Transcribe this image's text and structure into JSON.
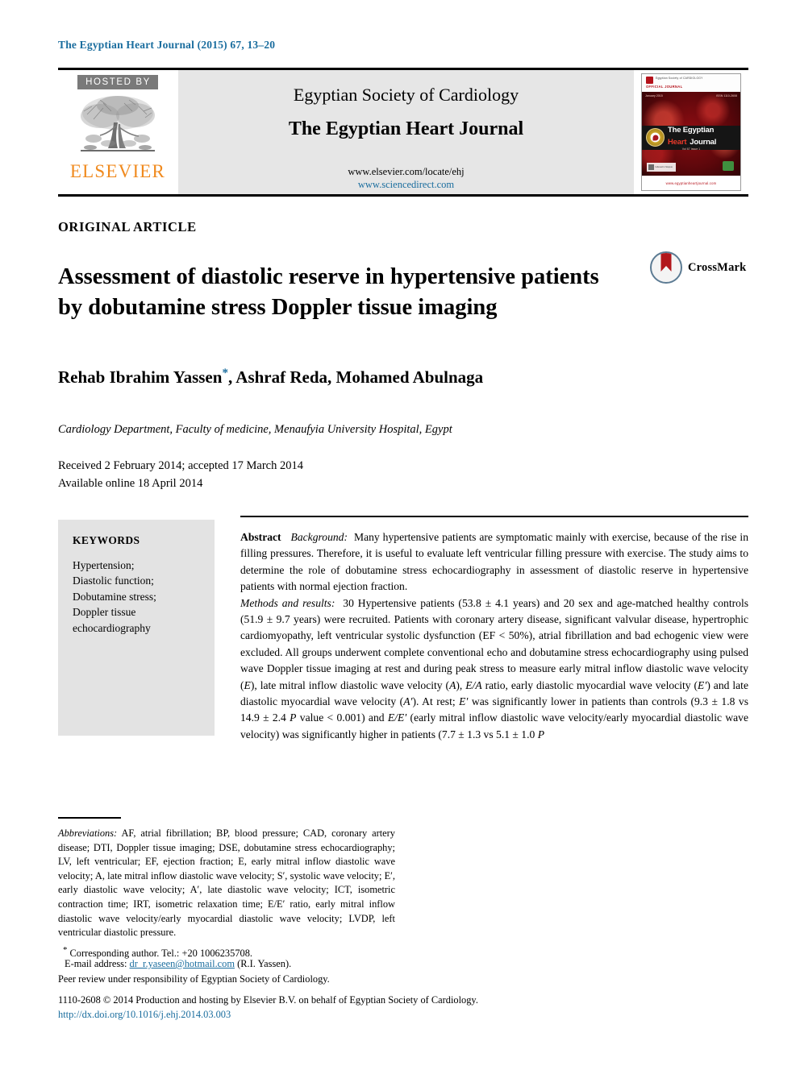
{
  "journal_ref": "The Egyptian Heart Journal (2015) 67, 13–20",
  "masthead": {
    "hosted_by": "HOSTED BY",
    "publisher": "ELSEVIER",
    "society": "Egyptian Society of Cardiology",
    "journal_title": "The Egyptian Heart Journal",
    "url_locate": "www.elsevier.com/locate/ehj",
    "url_sciencedirect": "www.sciencedirect.com",
    "cover": {
      "esc_line1": "Egyptian Society of CARDIOLOGY",
      "esc_line2": "OFFICIAL JOURNAL",
      "issue_left": "January 2015",
      "issue_right": "ISSN 1110-2608",
      "title_line1": "The Egyptian",
      "title_line2a": "Heart",
      "title_line2b": "Journal",
      "subtitle": "Vol 67 Issue 1",
      "badge_text": "Indexed in Scopus",
      "website": "www.egyptianheartjournal.com"
    }
  },
  "article": {
    "type": "ORIGINAL ARTICLE",
    "title": "Assessment of diastolic reserve in hypertensive patients by dobutamine stress Doppler tissue imaging",
    "crossmark_label": "CrossMark",
    "authors_pre": "Rehab Ibrahim Yassen",
    "authors_star": "*",
    "authors_post": ", Ashraf Reda, Mohamed Abulnaga",
    "affiliation": "Cardiology Department, Faculty of medicine, Menaufyia University Hospital, Egypt",
    "received": "Received 2 February 2014; accepted 17 March 2014",
    "available_online": "Available online 18 April 2014"
  },
  "keywords": {
    "heading": "KEYWORDS",
    "items": "Hypertension; Diastolic function; Dobutamine stress; Doppler tissue echocardiography"
  },
  "abstract": {
    "label": "Abstract",
    "background_label": "Background:",
    "background_text": "Many hypertensive patients are symptomatic mainly with exercise, because of the rise in filling pressures. Therefore, it is useful to evaluate left ventricular filling pressure with exercise. The study aims to determine the role of dobutamine stress echocardiography in assessment of diastolic reserve in hypertensive patients with normal ejection fraction.",
    "methods_label": "Methods and results:",
    "methods_text_1": "30 Hypertensive patients (53.8 ± 4.1 years) and 20 sex and age-matched healthy controls (51.9 ± 9.7 years) were recruited. Patients with coronary artery disease, significant valvular disease, hypertrophic cardiomyopathy, left ventricular systolic dysfunction (EF < 50%), atrial fibrillation and bad echogenic view were excluded. All groups underwent complete conventional echo and dobutamine stress echocardiography using pulsed wave Doppler tissue imaging at rest and during peak stress to measure early mitral inflow diastolic wave velocity (",
    "sym_E": "E",
    "methods_text_2": "), late mitral inflow diastolic wave velocity (",
    "sym_A": "A",
    "methods_text_3": "), ",
    "sym_EA": "E/A",
    "methods_text_4": " ratio, early diastolic myocardial wave velocity (",
    "sym_Eprime": "E′",
    "methods_text_5": ") and late diastolic myocardial wave velocity (",
    "sym_Aprime": "A′",
    "methods_text_6": "). At rest; ",
    "sym_Eprime_2": "E′",
    "methods_text_7": " was significantly lower in patients than controls (9.3 ± 1.8 vs 14.9 ± 2.4 ",
    "sym_P": "P",
    "methods_text_8": " value < 0.001) and ",
    "sym_EEprime": "E/E′",
    "methods_text_9": " (early mitral inflow diastolic wave velocity/early myocardial diastolic wave velocity) was significantly higher in patients (7.7 ± 1.3 vs 5.1 ± 1.0 ",
    "sym_P2": "P",
    "methods_text_10": ""
  },
  "footnotes": {
    "abbrev_label": "Abbreviations:",
    "abbrev_text": "AF, atrial fibrillation; BP, blood pressure; CAD, coronary artery disease; DTI, Doppler tissue imaging; DSE, dobutamine stress echocardiography; LV, left ventricular; EF, ejection fraction; E, early mitral inflow diastolic wave velocity; A, late mitral inflow diastolic wave velocity; S′, systolic wave velocity; E′, early diastolic wave velocity; A′, late diastolic wave velocity; ICT, isometric contraction time; IRT, isometric relaxation time; E/E′ ratio, early mitral inflow diastolic wave velocity/early myocardial diastolic wave velocity; LVDP, left ventricular diastolic pressure.",
    "corresponding_star": "*",
    "corresponding": "Corresponding author. Tel.: +20 1006235708.",
    "email_label": "E-mail address:",
    "email": "dr_r.yaseen@hotmail.com",
    "email_owner": "(R.I. Yassen).",
    "peer_review": "Peer review under responsibility of Egyptian Society of Cardiology.",
    "copyright": "1110-2608 © 2014 Production and hosting by Elsevier B.V. on behalf of Egyptian Society of Cardiology.",
    "doi": "http://dx.doi.org/10.1016/j.ehj.2014.03.003"
  }
}
